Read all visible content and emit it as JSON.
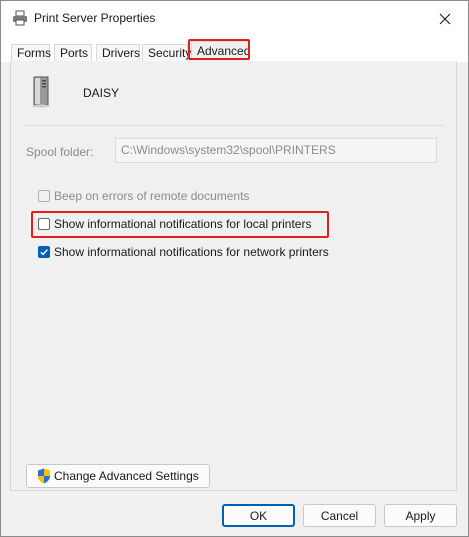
{
  "window": {
    "title": "Print Server Properties"
  },
  "tabs": [
    {
      "label": "Forms"
    },
    {
      "label": "Ports"
    },
    {
      "label": "Drivers"
    },
    {
      "label": "Security"
    },
    {
      "label": "Advanced"
    }
  ],
  "active_tab": "Advanced",
  "server": {
    "name": "DAISY"
  },
  "spool": {
    "label": "Spool folder:",
    "value": "C:\\Windows\\system32\\spool\\PRINTERS"
  },
  "options": [
    {
      "label": "Beep on errors of remote documents",
      "checked": false,
      "enabled": false
    },
    {
      "label": "Show informational notifications for local printers",
      "checked": false,
      "enabled": true
    },
    {
      "label": "Show informational notifications for network printers",
      "checked": true,
      "enabled": true
    }
  ],
  "advanced_button": {
    "label": "Change Advanced Settings"
  },
  "footer": {
    "ok_label": "OK",
    "cancel_label": "Cancel",
    "apply_label": "Apply"
  },
  "colors": {
    "accent": "#005fb8",
    "highlight": "#e0201a",
    "shield_blue": "#2b6fd6",
    "shield_yellow": "#f4c20d"
  }
}
